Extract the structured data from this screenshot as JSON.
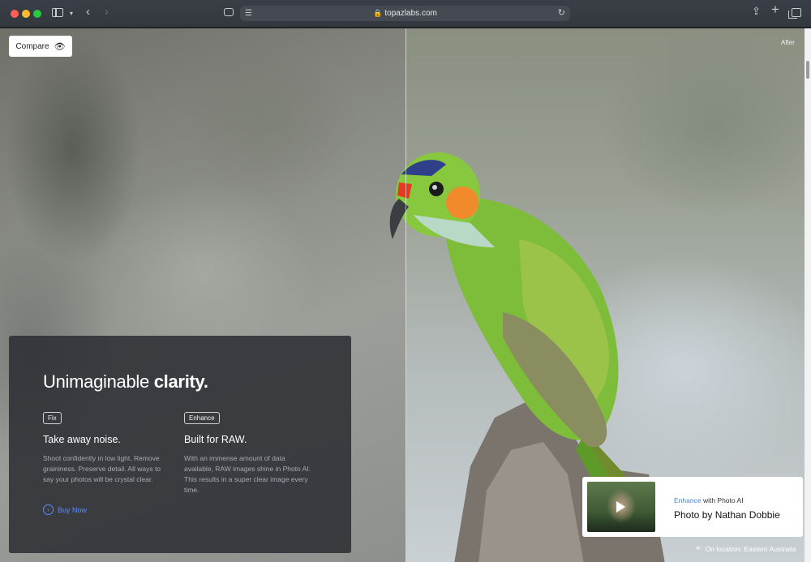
{
  "browser": {
    "url": "topazlabs.com",
    "icons": [
      "sidebar-icon",
      "chevron-down-icon",
      "back-icon",
      "forward-icon",
      "extension-icon",
      "reader-icon",
      "lock-icon",
      "reload-icon",
      "share-icon",
      "plus-icon",
      "tabs-icon"
    ]
  },
  "hero": {
    "compare_label": "Compare",
    "after_label": "After"
  },
  "panel": {
    "title_light": "Unimaginable",
    "title_bold": "clarity.",
    "features": [
      {
        "tag": "Fix",
        "heading": "Take away noise.",
        "body": "Shoot confidently in low light. Remove graininess. Preserve detail. All ways to say your photos will be crystal clear."
      },
      {
        "tag": "Enhance",
        "heading": "Built for RAW.",
        "body": "With an immense amount of data available, RAW images shine in Photo AI. This results in a super clear image every time."
      }
    ],
    "cta": "Buy Now"
  },
  "photo_card": {
    "accent": "Enhance",
    "subtitle_rest": "with Photo AI",
    "title": "Photo by Nathan Dobbie"
  },
  "location": "On location: Eastern Australia",
  "colors": {
    "accent_blue": "#5b8cff",
    "panel_bg": "#2d2f34"
  }
}
